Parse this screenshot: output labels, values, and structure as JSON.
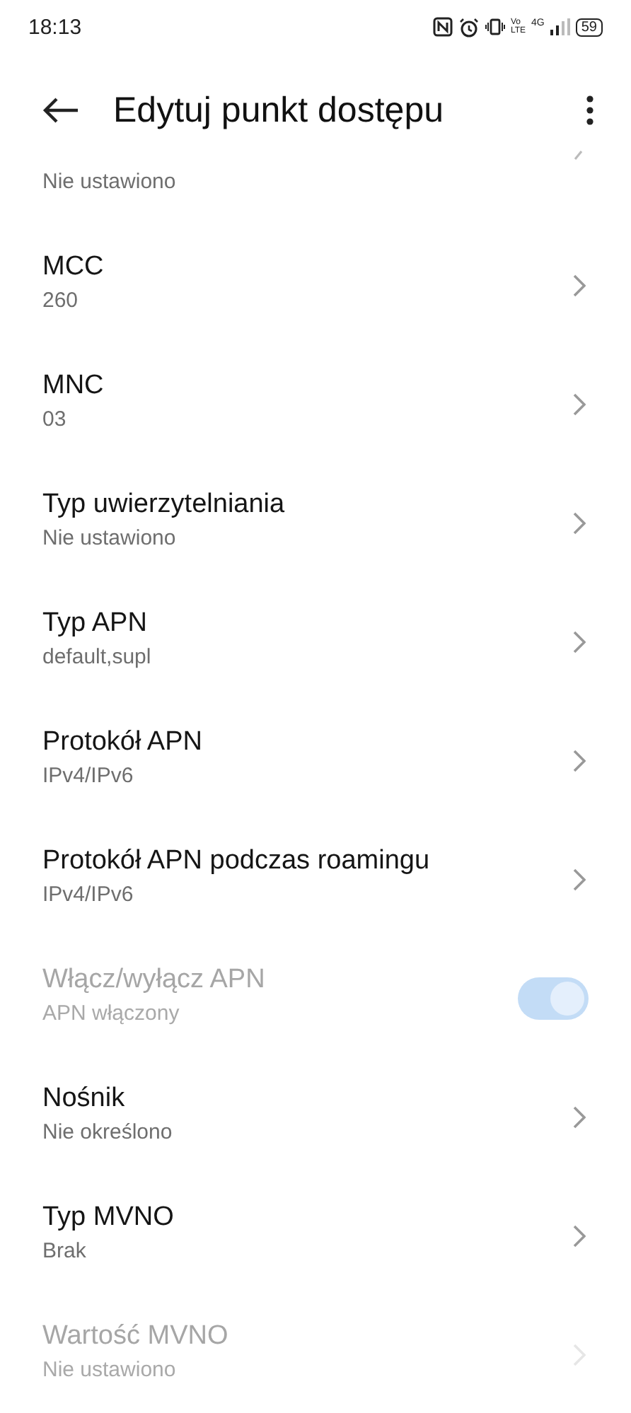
{
  "status_bar": {
    "time": "18:13",
    "volte_top": "Vo",
    "volte_bottom": "LTE",
    "network": "4G",
    "battery": "59"
  },
  "header": {
    "title": "Edytuj punkt dostępu"
  },
  "partial_item": {
    "subtitle": "Nie ustawiono"
  },
  "items": [
    {
      "kind": "nav",
      "title": "MCC",
      "subtitle": "260",
      "disabled": false
    },
    {
      "kind": "nav",
      "title": "MNC",
      "subtitle": "03",
      "disabled": false
    },
    {
      "kind": "nav",
      "title": "Typ uwierzytelniania",
      "subtitle": "Nie ustawiono",
      "disabled": false
    },
    {
      "kind": "nav",
      "title": "Typ APN",
      "subtitle": "default,supl",
      "disabled": false
    },
    {
      "kind": "nav",
      "title": "Protokół APN",
      "subtitle": "IPv4/IPv6",
      "disabled": false
    },
    {
      "kind": "nav",
      "title": "Protokół APN podczas roamingu",
      "subtitle": "IPv4/IPv6",
      "disabled": false
    },
    {
      "kind": "toggle",
      "title": "Włącz/wyłącz APN",
      "subtitle": "APN włączony",
      "disabled": true,
      "on": true
    },
    {
      "kind": "nav",
      "title": "Nośnik",
      "subtitle": "Nie określono",
      "disabled": false
    },
    {
      "kind": "nav",
      "title": "Typ MVNO",
      "subtitle": "Brak",
      "disabled": false
    },
    {
      "kind": "nav",
      "title": "Wartość MVNO",
      "subtitle": "Nie ustawiono",
      "disabled": true
    }
  ]
}
